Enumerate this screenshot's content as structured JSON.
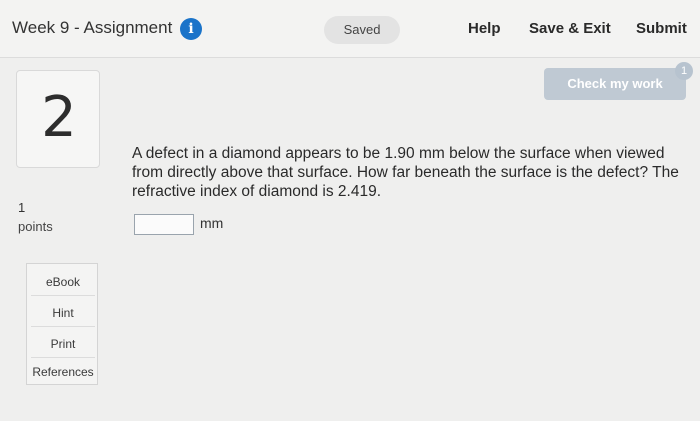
{
  "header": {
    "title": "Week 9 - Assignment",
    "info_icon": "i",
    "saved_status": "Saved",
    "help_label": "Help",
    "save_exit_label": "Save & Exit",
    "submit_label": "Submit"
  },
  "check": {
    "label": "Check my work",
    "badge_count": "1"
  },
  "question": {
    "number": "2",
    "points_value": "1",
    "points_label": "points",
    "text": "A defect in a diamond appears to be 1.90 mm below the surface when viewed from directly above that surface. How far beneath the surface is the defect? The refractive index of diamond is 2.419.",
    "answer_value": "",
    "answer_unit": "mm"
  },
  "resources": {
    "items": [
      "eBook",
      "Hint",
      "Print",
      "References"
    ]
  }
}
